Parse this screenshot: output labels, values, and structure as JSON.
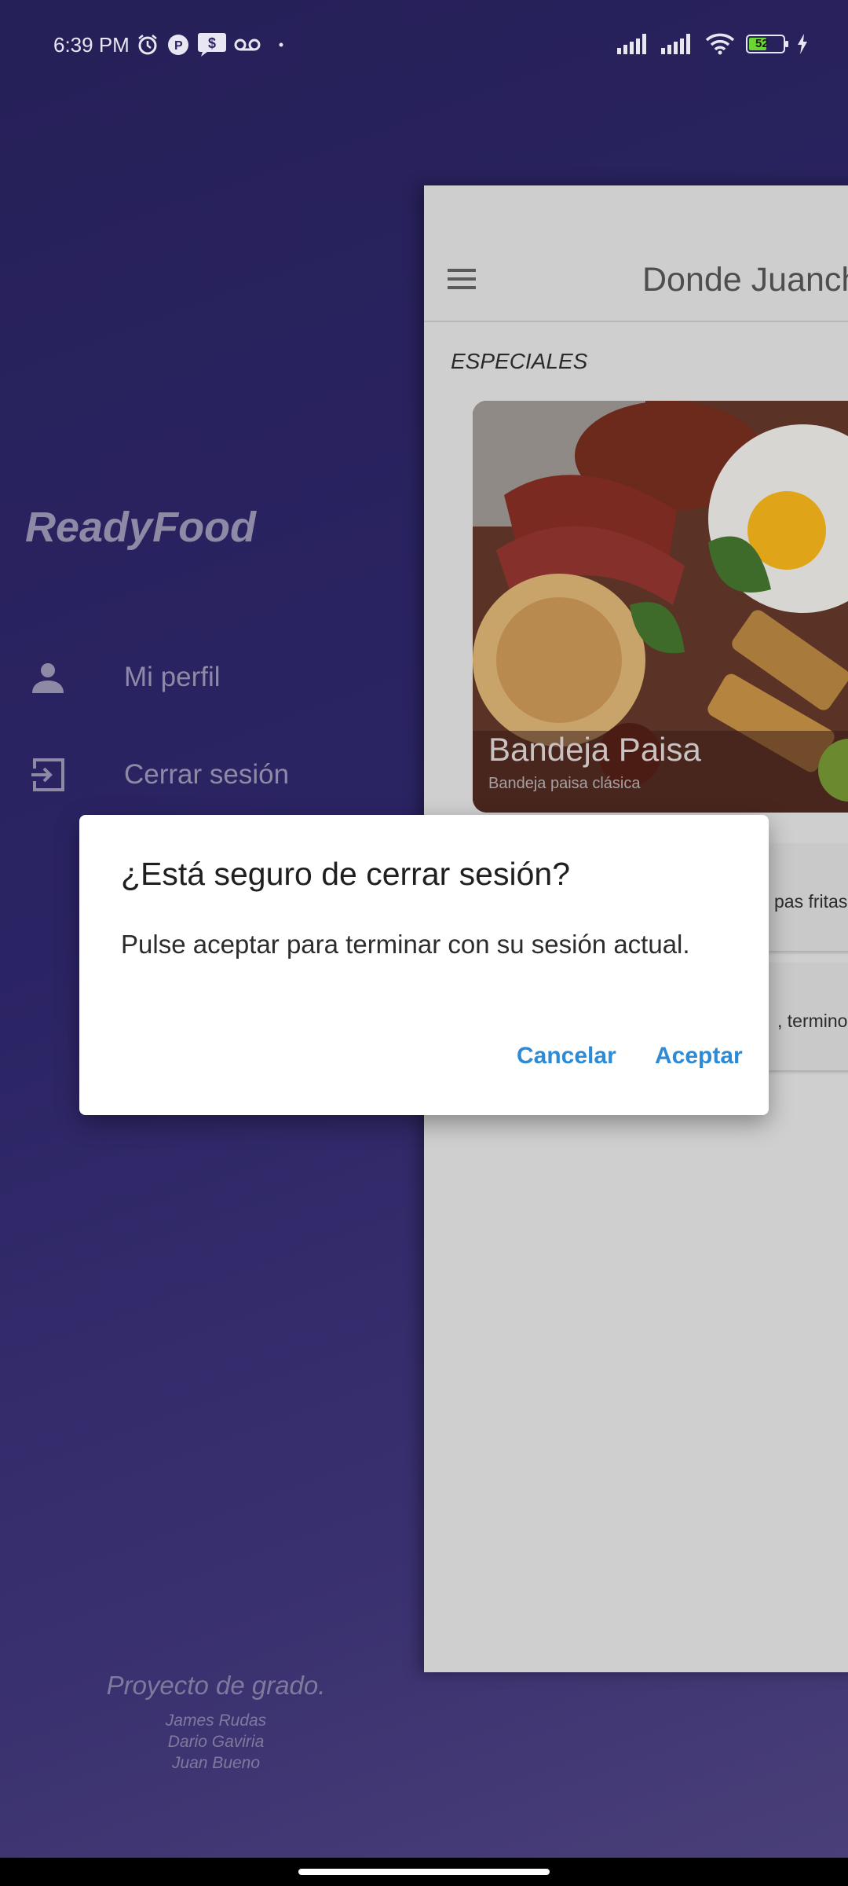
{
  "status_bar": {
    "time": "6:39 PM",
    "battery_level": "52",
    "left_icons": [
      "alarm-icon",
      "notification-p-icon",
      "message-dollar-icon",
      "voicemail-icon",
      "dot-icon"
    ],
    "right_icons": [
      "signal-icon",
      "signal-icon",
      "wifi-icon",
      "battery-icon",
      "charging-icon"
    ]
  },
  "drawer": {
    "app_name": "ReadyFood",
    "items": [
      {
        "label": "Mi perfil",
        "icon": "person-icon"
      },
      {
        "label": "Cerrar sesión",
        "icon": "logout-icon"
      }
    ],
    "footer": {
      "project": "Proyecto de grado.",
      "authors": [
        "James Rudas",
        "Dario Gaviria",
        "Juan Bueno"
      ]
    }
  },
  "main": {
    "appbar_title": "Donde Juancho",
    "section_label": "ESPECIALES",
    "special": {
      "name": "Bandeja Paisa",
      "description": "Bandeja paisa clásica"
    },
    "list_items": [
      {
        "text": "pas fritas"
      },
      {
        "text": ", termino"
      }
    ]
  },
  "dialog": {
    "title": "¿Está seguro de cerrar sesión?",
    "message": "Pulse aceptar para terminar con su sesión actual.",
    "cancel_label": "Cancelar",
    "accept_label": "Aceptar",
    "accent_color": "#2d8ad6"
  },
  "colors": {
    "drawer_bg": "#2b2464",
    "dialog_bg": "#ffffff",
    "dialog_button": "#2d8ad6"
  }
}
